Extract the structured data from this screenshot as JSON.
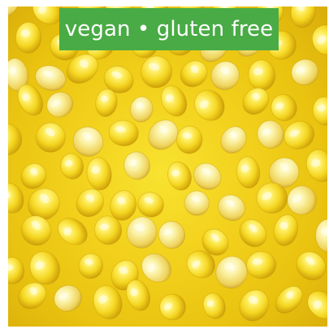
{
  "badge": {
    "text": "vegan • gluten free",
    "background_color": "#49ab45",
    "text_color": "#ffffff"
  },
  "photo": {
    "subject": "corn-kernels",
    "kernel_color": "#f3d21d"
  }
}
